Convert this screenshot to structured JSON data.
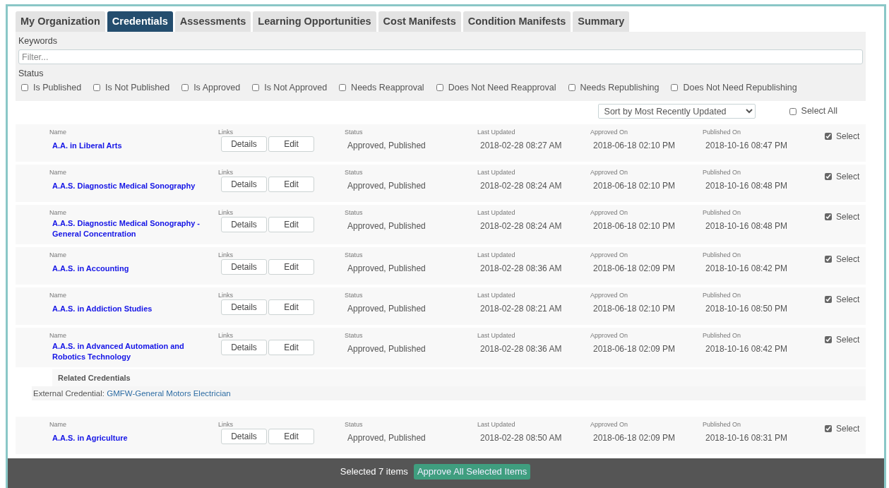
{
  "tabs": [
    {
      "label": "My Organization",
      "selected": false
    },
    {
      "label": "Credentials",
      "selected": true
    },
    {
      "label": "Assessments",
      "selected": false
    },
    {
      "label": "Learning Opportunities",
      "selected": false
    },
    {
      "label": "Cost Manifests",
      "selected": false
    },
    {
      "label": "Condition Manifests",
      "selected": false
    },
    {
      "label": "Summary",
      "selected": false
    }
  ],
  "filter": {
    "keywords_label": "Keywords",
    "placeholder": "Filter...",
    "status_label": "Status",
    "status_options": [
      {
        "label": "Is Published",
        "checked": false
      },
      {
        "label": "Is Not Published",
        "checked": false
      },
      {
        "label": "Is Approved",
        "checked": false
      },
      {
        "label": "Is Not Approved",
        "checked": false
      },
      {
        "label": "Needs Reapproval",
        "checked": false
      },
      {
        "label": "Does Not Need Reapproval",
        "checked": false
      },
      {
        "label": "Needs Republishing",
        "checked": false
      },
      {
        "label": "Does Not Need Republishing",
        "checked": false
      }
    ]
  },
  "sort": {
    "value": "Sort by Most Recently Updated"
  },
  "select_all": {
    "label": "Select All",
    "checked": false
  },
  "rows": [
    {
      "name_label": "Name",
      "name": "A.A. in Liberal Arts",
      "links_label": "Links",
      "details": "Details",
      "edit": "Edit",
      "status_label": "Status",
      "status": "Approved, Published",
      "last_updated_label": "Last Updated",
      "last_updated": "2018-02-28 08:27 AM",
      "approved_on_label": "Approved On",
      "approved_on": "2018-06-18 02:10 PM",
      "published_on_label": "Published On",
      "published_on": "2018-10-16 08:47 PM",
      "select_label": "Select",
      "checked": true
    },
    {
      "name_label": "Name",
      "name": "A.A.S. Diagnostic Medical Sonography",
      "links_label": "Links",
      "details": "Details",
      "edit": "Edit",
      "status_label": "Status",
      "status": "Approved, Published",
      "last_updated_label": "Last Updated",
      "last_updated": "2018-02-28 08:24 AM",
      "approved_on_label": "Approved On",
      "approved_on": "2018-06-18 02:10 PM",
      "published_on_label": "Published On",
      "published_on": "2018-10-16 08:48 PM",
      "select_label": "Select",
      "checked": true
    },
    {
      "name_label": "Name",
      "name": "A.A.S. Diagnostic Medical Sonography - General Concentration",
      "links_label": "Links",
      "details": "Details",
      "edit": "Edit",
      "status_label": "Status",
      "status": "Approved, Published",
      "last_updated_label": "Last Updated",
      "last_updated": "2018-02-28 08:24 AM",
      "approved_on_label": "Approved On",
      "approved_on": "2018-06-18 02:10 PM",
      "published_on_label": "Published On",
      "published_on": "2018-10-16 08:48 PM",
      "select_label": "Select",
      "checked": true
    },
    {
      "name_label": "Name",
      "name": "A.A.S. in Accounting",
      "links_label": "Links",
      "details": "Details",
      "edit": "Edit",
      "status_label": "Status",
      "status": "Approved, Published",
      "last_updated_label": "Last Updated",
      "last_updated": "2018-02-28 08:36 AM",
      "approved_on_label": "Approved On",
      "approved_on": "2018-06-18 02:09 PM",
      "published_on_label": "Published On",
      "published_on": "2018-10-16 08:42 PM",
      "select_label": "Select",
      "checked": true
    },
    {
      "name_label": "Name",
      "name": "A.A.S. in Addiction Studies",
      "links_label": "Links",
      "details": "Details",
      "edit": "Edit",
      "status_label": "Status",
      "status": "Approved, Published",
      "last_updated_label": "Last Updated",
      "last_updated": "2018-02-28 08:21 AM",
      "approved_on_label": "Approved On",
      "approved_on": "2018-06-18 02:10 PM",
      "published_on_label": "Published On",
      "published_on": "2018-10-16 08:50 PM",
      "select_label": "Select",
      "checked": true
    },
    {
      "name_label": "Name",
      "name": "A.A.S. in Advanced Automation and Robotics Technology",
      "links_label": "Links",
      "details": "Details",
      "edit": "Edit",
      "status_label": "Status",
      "status": "Approved, Published",
      "last_updated_label": "Last Updated",
      "last_updated": "2018-02-28 08:36 AM",
      "approved_on_label": "Approved On",
      "approved_on": "2018-06-18 02:09 PM",
      "published_on_label": "Published On",
      "published_on": "2018-10-16 08:42 PM",
      "select_label": "Select",
      "checked": true,
      "related": {
        "title": "Related Credentials",
        "prefix": "External Credential:",
        "link": "GMFW-General Motors Electrician"
      }
    },
    {
      "name_label": "Name",
      "name": "A.A.S. in Agriculture",
      "links_label": "Links",
      "details": "Details",
      "edit": "Edit",
      "status_label": "Status",
      "status": "Approved, Published",
      "last_updated_label": "Last Updated",
      "last_updated": "2018-02-28 08:50 AM",
      "approved_on_label": "Approved On",
      "approved_on": "2018-06-18 02:09 PM",
      "published_on_label": "Published On",
      "published_on": "2018-10-16 08:31 PM",
      "select_label": "Select",
      "checked": true
    }
  ],
  "footer": {
    "count": "Selected 7 items",
    "button": "Approve All Selected Items"
  }
}
